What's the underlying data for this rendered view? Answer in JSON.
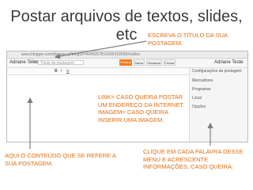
{
  "slide": {
    "title": "Postar arquivos de textos, slides, etc"
  },
  "browser": {
    "address": "www.blogger.com/blogger.g?blogID=4945057816435418096#editor/target=post"
  },
  "editor_header": {
    "blog_name": "Adriane Teste",
    "section": "Postagem",
    "post_title_placeholder": "Título da postagem",
    "publish_label": "Publicar",
    "save_label": "Salvar",
    "preview_label": "Visualizar",
    "close_label": "Fechar",
    "user_name": "Adriane Teste"
  },
  "toolbar": {
    "bold": "B",
    "italic": "I",
    "underline": "U"
  },
  "settings_sidebar": {
    "heading": "Configurações da postagem",
    "items": [
      "Marcadores",
      "Programar",
      "Local",
      "Opções"
    ]
  },
  "annotations": {
    "title_hint": "ESCREVA O TÍTULO DA SUA POSTAGEM.",
    "link_image_hint": "LINK= CASO QUEIRA POSTAR UM ENDEREÇO DA INTERNET. IMAGEM= CASO QUEIRA INSERIR UMA IMAGEM.",
    "content_hint": "AQUI O CONTEÚDO QUE SE REFERE A SUA POSTAGEM.",
    "settings_hint": "CLIQUE EM CADA PALAVRA DESSE MENU E ACRESCENTE INFORMAÇÕES, CASO QUEIRA."
  },
  "colors": {
    "annotation_orange": "#e36c0a",
    "annotation_blue": "#1f497d",
    "arrow": "#7f7f7f",
    "publish_button": "#f47a1f"
  }
}
